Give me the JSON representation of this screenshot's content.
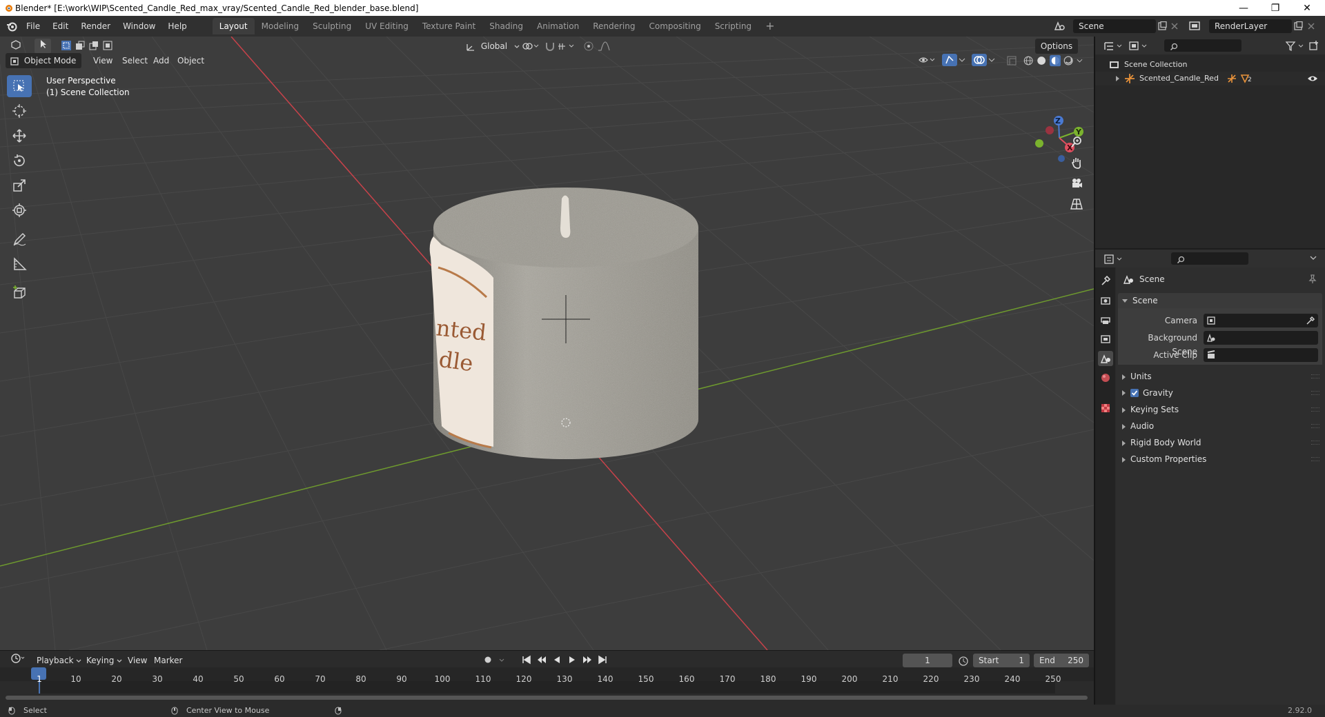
{
  "window": {
    "title": "Blender* [E:\\work\\WIP\\Scented_Candle_Red_max_vray/Scented_Candle_Red_blender_base.blend]",
    "minimize": "—",
    "maximize": "❐",
    "close": "✕"
  },
  "menubar": {
    "menus": [
      "File",
      "Edit",
      "Render",
      "Window",
      "Help"
    ],
    "workspaces": [
      "Layout",
      "Modeling",
      "Sculpting",
      "UV Editing",
      "Texture Paint",
      "Shading",
      "Animation",
      "Rendering",
      "Compositing",
      "Scripting"
    ],
    "active_workspace": "Layout",
    "add_tab": "+",
    "scene_value": "Scene",
    "view_layer_value": "RenderLayer"
  },
  "viewport_header": {
    "transform_orientation": "Global",
    "options_label": "Options",
    "mode": "Object Mode",
    "menus": [
      "View",
      "Select",
      "Add",
      "Object"
    ]
  },
  "viewport": {
    "overlay_line1": "User Perspective",
    "overlay_line2": "(1) Scene Collection",
    "label_text_line1": "nted",
    "label_text_line2": "dle",
    "gizmo": {
      "z": "Z",
      "y": "Y",
      "x": "X"
    },
    "colors": {
      "background": "#3d3d3d",
      "x_axis": "#c8424a",
      "y_axis": "#6e9a2e",
      "select_blue": "#4772b3"
    }
  },
  "timeline": {
    "menus": [
      "Playback",
      "Keying",
      "View",
      "Marker"
    ],
    "current_frame": "1",
    "start_label": "Start",
    "start_value": "1",
    "end_label": "End",
    "end_value": "250",
    "ruler": [
      "1",
      "10",
      "20",
      "30",
      "40",
      "50",
      "60",
      "70",
      "80",
      "90",
      "100",
      "110",
      "120",
      "130",
      "140",
      "150",
      "160",
      "170",
      "180",
      "190",
      "200",
      "210",
      "220",
      "230",
      "240",
      "250"
    ]
  },
  "statusbar": {
    "select": "Select",
    "center_view": "Center View to Mouse",
    "version": "2.92.0"
  },
  "outliner": {
    "root": "Scene Collection",
    "items": [
      {
        "name": "Scented_Candle_Red",
        "badge": "2"
      }
    ]
  },
  "properties": {
    "context": "Scene",
    "panel_title": "Scene",
    "fields": [
      {
        "label": "Camera"
      },
      {
        "label": "Background Scene"
      },
      {
        "label": "Active Clip"
      }
    ],
    "sections": [
      "Units",
      "Gravity",
      "Keying Sets",
      "Audio",
      "Rigid Body World",
      "Custom Properties"
    ],
    "gravity_checked": true
  }
}
